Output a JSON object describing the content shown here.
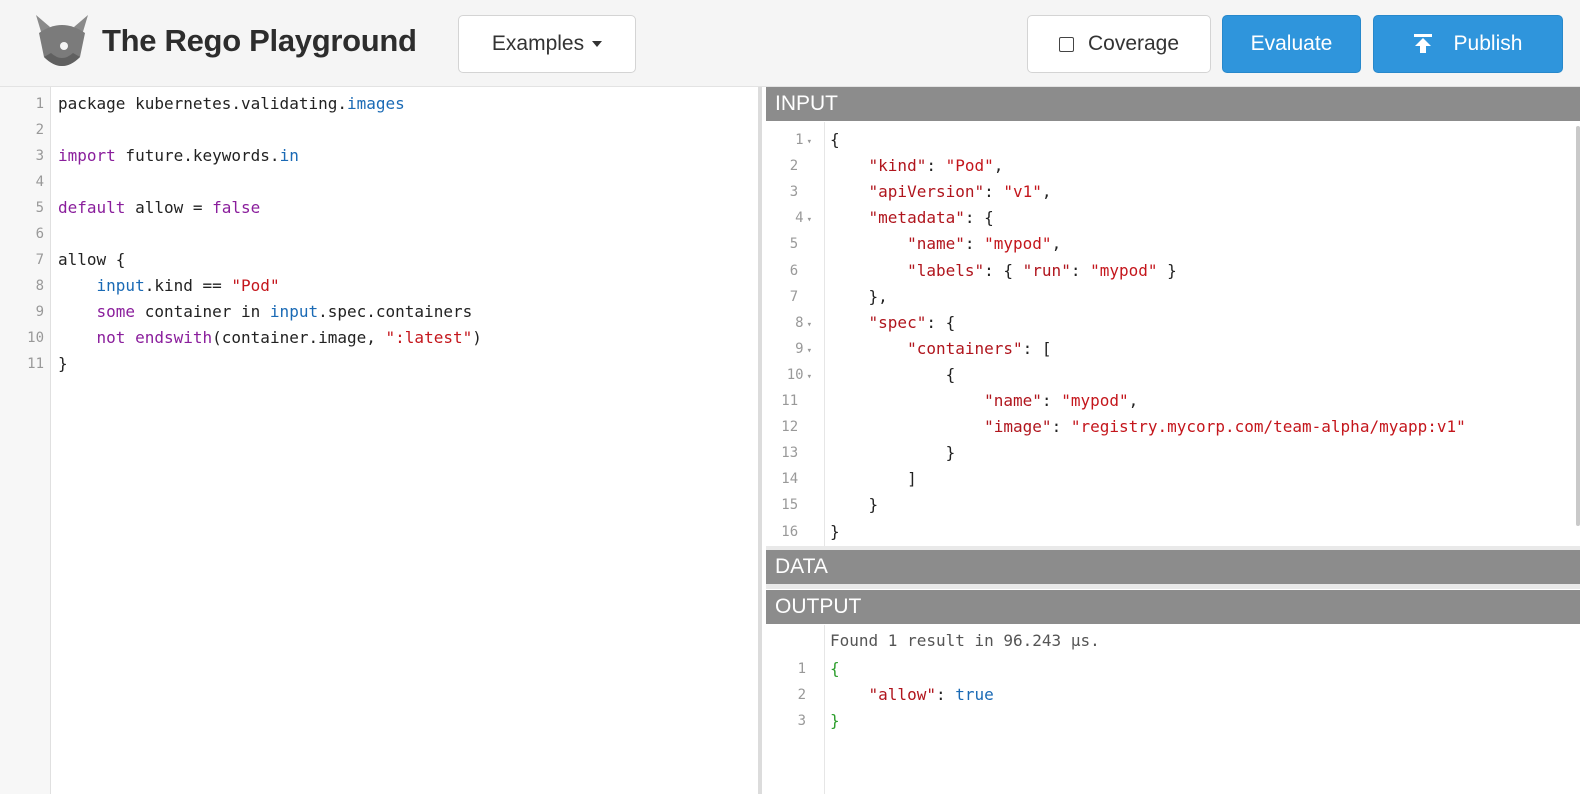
{
  "header": {
    "title": "The Rego Playground",
    "examples_label": "Examples",
    "coverage_label": "Coverage",
    "coverage_checked": false,
    "evaluate_label": "Evaluate",
    "publish_label": "Publish"
  },
  "colors": {
    "primary_button": "#2f95dc",
    "section_bar": "#8c8c8c",
    "keyword": "#8a1e9c",
    "builtin": "#1a6ab5",
    "string": "#c4161c"
  },
  "policy": {
    "lines": [
      {
        "n": "1",
        "segments": [
          {
            "t": "package kubernetes.validating.",
            "c": ""
          },
          {
            "t": "images",
            "c": "bl"
          }
        ]
      },
      {
        "n": "2",
        "segments": []
      },
      {
        "n": "3",
        "segments": [
          {
            "t": "import",
            "c": "kw"
          },
          {
            "t": " future.keywords.",
            "c": ""
          },
          {
            "t": "in",
            "c": "bl"
          }
        ]
      },
      {
        "n": "4",
        "segments": []
      },
      {
        "n": "5",
        "segments": [
          {
            "t": "default",
            "c": "kw"
          },
          {
            "t": " allow = ",
            "c": ""
          },
          {
            "t": "false",
            "c": "kw"
          }
        ]
      },
      {
        "n": "6",
        "segments": []
      },
      {
        "n": "7",
        "segments": [
          {
            "t": "allow {",
            "c": ""
          }
        ]
      },
      {
        "n": "8",
        "segments": [
          {
            "t": "    ",
            "c": ""
          },
          {
            "t": "input",
            "c": "bl"
          },
          {
            "t": ".kind == ",
            "c": ""
          },
          {
            "t": "\"Pod\"",
            "c": "st"
          }
        ]
      },
      {
        "n": "9",
        "segments": [
          {
            "t": "    ",
            "c": ""
          },
          {
            "t": "some",
            "c": "kw"
          },
          {
            "t": " container in ",
            "c": ""
          },
          {
            "t": "input",
            "c": "bl"
          },
          {
            "t": ".spec.containers",
            "c": ""
          }
        ]
      },
      {
        "n": "10",
        "segments": [
          {
            "t": "    ",
            "c": ""
          },
          {
            "t": "not",
            "c": "kw"
          },
          {
            "t": " ",
            "c": ""
          },
          {
            "t": "endswith",
            "c": "kw"
          },
          {
            "t": "(container.image, ",
            "c": ""
          },
          {
            "t": "\":latest\"",
            "c": "st"
          },
          {
            "t": ")",
            "c": ""
          }
        ]
      },
      {
        "n": "11",
        "segments": [
          {
            "t": "}",
            "c": ""
          }
        ]
      }
    ]
  },
  "input_section": {
    "label": "INPUT",
    "lines": [
      {
        "n": "1",
        "fold": true,
        "segments": [
          {
            "t": "{",
            "c": ""
          }
        ]
      },
      {
        "n": "2",
        "fold": false,
        "segments": [
          {
            "t": "    ",
            "c": ""
          },
          {
            "t": "\"kind\"",
            "c": "key"
          },
          {
            "t": ": ",
            "c": ""
          },
          {
            "t": "\"Pod\"",
            "c": "st"
          },
          {
            "t": ",",
            "c": ""
          }
        ]
      },
      {
        "n": "3",
        "fold": false,
        "segments": [
          {
            "t": "    ",
            "c": ""
          },
          {
            "t": "\"apiVersion\"",
            "c": "key"
          },
          {
            "t": ": ",
            "c": ""
          },
          {
            "t": "\"v1\"",
            "c": "st"
          },
          {
            "t": ",",
            "c": ""
          }
        ]
      },
      {
        "n": "4",
        "fold": true,
        "segments": [
          {
            "t": "    ",
            "c": ""
          },
          {
            "t": "\"metadata\"",
            "c": "key"
          },
          {
            "t": ": {",
            "c": ""
          }
        ]
      },
      {
        "n": "5",
        "fold": false,
        "segments": [
          {
            "t": "        ",
            "c": ""
          },
          {
            "t": "\"name\"",
            "c": "key"
          },
          {
            "t": ": ",
            "c": ""
          },
          {
            "t": "\"mypod\"",
            "c": "st"
          },
          {
            "t": ",",
            "c": ""
          }
        ]
      },
      {
        "n": "6",
        "fold": false,
        "segments": [
          {
            "t": "        ",
            "c": ""
          },
          {
            "t": "\"labels\"",
            "c": "key"
          },
          {
            "t": ": { ",
            "c": ""
          },
          {
            "t": "\"run\"",
            "c": "key"
          },
          {
            "t": ": ",
            "c": ""
          },
          {
            "t": "\"mypod\"",
            "c": "st"
          },
          {
            "t": " }",
            "c": ""
          }
        ]
      },
      {
        "n": "7",
        "fold": false,
        "segments": [
          {
            "t": "    },",
            "c": ""
          }
        ]
      },
      {
        "n": "8",
        "fold": true,
        "segments": [
          {
            "t": "    ",
            "c": ""
          },
          {
            "t": "\"spec\"",
            "c": "key"
          },
          {
            "t": ": {",
            "c": ""
          }
        ]
      },
      {
        "n": "9",
        "fold": true,
        "segments": [
          {
            "t": "        ",
            "c": ""
          },
          {
            "t": "\"containers\"",
            "c": "key"
          },
          {
            "t": ": [",
            "c": ""
          }
        ]
      },
      {
        "n": "10",
        "fold": true,
        "segments": [
          {
            "t": "            {",
            "c": ""
          }
        ]
      },
      {
        "n": "11",
        "fold": false,
        "segments": [
          {
            "t": "                ",
            "c": ""
          },
          {
            "t": "\"name\"",
            "c": "key"
          },
          {
            "t": ": ",
            "c": ""
          },
          {
            "t": "\"mypod\"",
            "c": "st"
          },
          {
            "t": ",",
            "c": ""
          }
        ]
      },
      {
        "n": "12",
        "fold": false,
        "segments": [
          {
            "t": "                ",
            "c": ""
          },
          {
            "t": "\"image\"",
            "c": "key"
          },
          {
            "t": ": ",
            "c": ""
          },
          {
            "t": "\"registry.mycorp.com/team-alpha/myapp:v1\"",
            "c": "st"
          }
        ]
      },
      {
        "n": "13",
        "fold": false,
        "segments": [
          {
            "t": "            }",
            "c": ""
          }
        ]
      },
      {
        "n": "14",
        "fold": false,
        "segments": [
          {
            "t": "        ]",
            "c": ""
          }
        ]
      },
      {
        "n": "15",
        "fold": false,
        "segments": [
          {
            "t": "    }",
            "c": ""
          }
        ]
      },
      {
        "n": "16",
        "fold": false,
        "segments": [
          {
            "t": "}",
            "c": ""
          }
        ]
      }
    ]
  },
  "data_section": {
    "label": "DATA"
  },
  "output_section": {
    "label": "OUTPUT",
    "status": "Found 1 result in 96.243 µs.",
    "lines": [
      {
        "n": "1",
        "segments": [
          {
            "t": "{",
            "c": "gr"
          }
        ]
      },
      {
        "n": "2",
        "segments": [
          {
            "t": "    ",
            "c": ""
          },
          {
            "t": "\"allow\"",
            "c": "key"
          },
          {
            "t": ": ",
            "c": ""
          },
          {
            "t": "true",
            "c": "bl"
          }
        ]
      },
      {
        "n": "3",
        "segments": [
          {
            "t": "}",
            "c": "gr"
          }
        ]
      }
    ]
  }
}
